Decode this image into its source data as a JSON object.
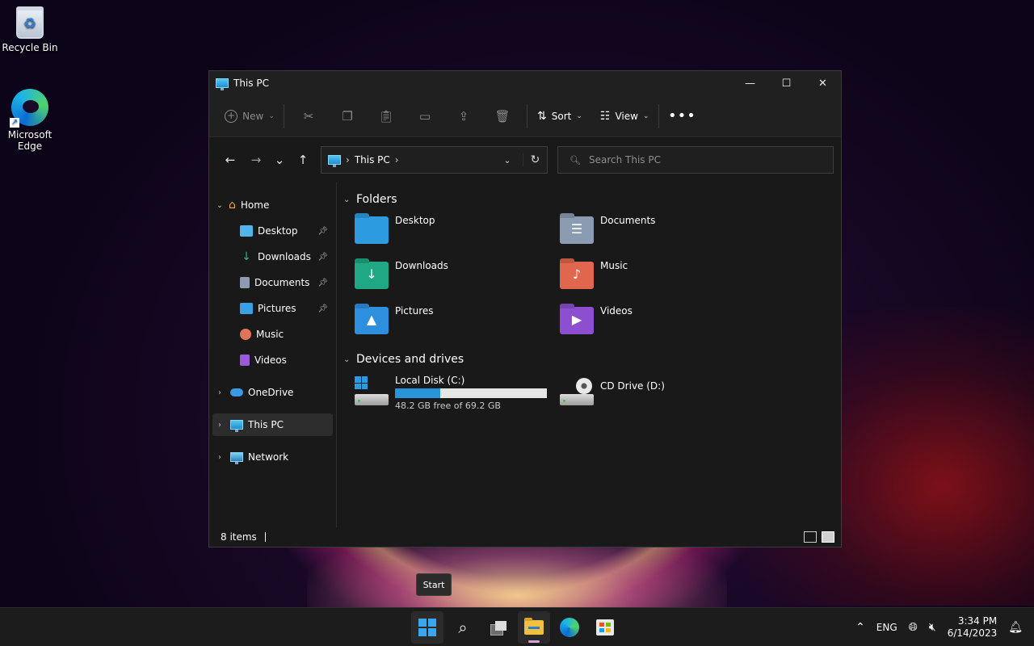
{
  "desktop": {
    "icons": [
      {
        "label": "Recycle Bin"
      },
      {
        "label": "Microsoft Edge"
      }
    ]
  },
  "window": {
    "title": "This PC",
    "controls": {
      "minimize": "—",
      "maximize": "☐",
      "close": "✕"
    }
  },
  "toolbar": {
    "new_label": "New",
    "sort_label": "Sort",
    "view_label": "View",
    "more": "•••"
  },
  "navigation": {
    "back": "←",
    "forward": "→",
    "recent": "⌄",
    "up": "↑",
    "breadcrumb": "This PC",
    "search_placeholder": "Search This PC"
  },
  "sidebar": {
    "home": "Home",
    "quick_access": [
      {
        "label": "Desktop",
        "color": "#4fb6ec"
      },
      {
        "label": "Downloads",
        "color": "#2fb58a"
      },
      {
        "label": "Documents",
        "color": "#8c9bb0"
      },
      {
        "label": "Pictures",
        "color": "#3aa0e4"
      },
      {
        "label": "Music",
        "color": "#e0745a"
      },
      {
        "label": "Videos",
        "color": "#9b5ad8"
      }
    ],
    "onedrive": "OneDrive",
    "this_pc": "This PC",
    "network": "Network"
  },
  "main": {
    "folders_header": "Folders",
    "folders": [
      {
        "label": "Desktop",
        "color": "#2c9be0",
        "glyph": ""
      },
      {
        "label": "Documents",
        "color": "#8b9bb2",
        "glyph": "☰"
      },
      {
        "label": "Downloads",
        "color": "#1fa883",
        "glyph": "↓"
      },
      {
        "label": "Music",
        "color": "#e0664e",
        "glyph": "♪"
      },
      {
        "label": "Pictures",
        "color": "#2f8fdf",
        "glyph": "▲"
      },
      {
        "label": "Videos",
        "color": "#8b4fd0",
        "glyph": "▶"
      }
    ],
    "drives_header": "Devices and drives",
    "drives": [
      {
        "label": "Local Disk (C:)",
        "free": "48.2 GB free of 69.2 GB",
        "used_fraction": 0.3
      },
      {
        "label": "CD Drive (D:)"
      }
    ]
  },
  "status": {
    "items": "8 items"
  },
  "tooltip": {
    "text": "Start"
  },
  "taskbar": {
    "language": "ENG",
    "time": "3:34 PM",
    "date": "6/14/2023"
  }
}
